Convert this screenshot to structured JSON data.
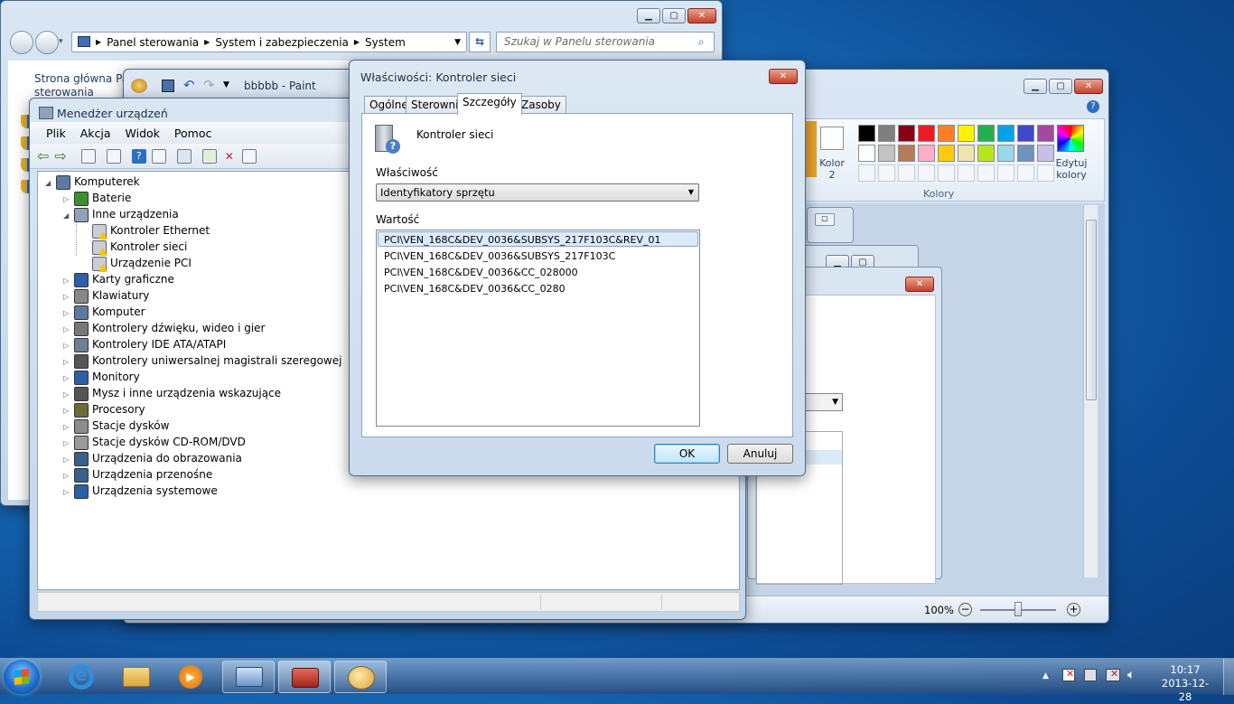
{
  "control_panel": {
    "breadcrumb": [
      "Panel sterowania",
      "System i zabezpieczenia",
      "System"
    ],
    "search_placeholder": "Szukaj w Panelu sterowania",
    "sidebar_link": "Strona główna Panelu sterowania",
    "sidebar_link_line1": "Strona główna Pan",
    "sidebar_link_line2": "sterowania"
  },
  "paint": {
    "title": "bbbbb - Paint",
    "color2_label_line1": "Kolor",
    "color2_label_line2": "2",
    "edit_colors_line1": "Edytuj",
    "edit_colors_line2": "kolory",
    "colors_group": "Kolory",
    "zoom": "100%",
    "palette_row1": [
      "#000000",
      "#7f7f7f",
      "#880015",
      "#ed1c24",
      "#ff7f27",
      "#fff200",
      "#22b14c",
      "#00a2e8",
      "#3f48cc",
      "#a349a4"
    ],
    "palette_row2": [
      "#ffffff",
      "#c3c3c3",
      "#b97a57",
      "#ffaec9",
      "#ffc90e",
      "#efe4b0",
      "#b5e61d",
      "#99d9ea",
      "#7092be",
      "#c8bfe7"
    ]
  },
  "device_manager": {
    "title": "Menedżer urządzeń",
    "menu": [
      "Plik",
      "Akcja",
      "Widok",
      "Pomoc"
    ],
    "tree": {
      "root": "Komputerek",
      "items": [
        {
          "label": "Baterie",
          "level": 1,
          "expanded": false
        },
        {
          "label": "Inne urządzenia",
          "level": 1,
          "expanded": true
        },
        {
          "label": "Kontroler Ethernet",
          "level": 2,
          "warning": true
        },
        {
          "label": "Kontroler sieci",
          "level": 2,
          "warning": true
        },
        {
          "label": "Urządzenie PCI",
          "level": 2,
          "warning": true
        },
        {
          "label": "Karty graficzne",
          "level": 1,
          "expanded": false
        },
        {
          "label": "Klawiatury",
          "level": 1,
          "expanded": false
        },
        {
          "label": "Komputer",
          "level": 1,
          "expanded": false
        },
        {
          "label": "Kontrolery dźwięku, wideo i gier",
          "level": 1,
          "expanded": false
        },
        {
          "label": "Kontrolery IDE ATA/ATAPI",
          "level": 1,
          "expanded": false
        },
        {
          "label": "Kontrolery uniwersalnej magistrali szeregowej",
          "level": 1,
          "expanded": false
        },
        {
          "label": "Monitory",
          "level": 1,
          "expanded": false
        },
        {
          "label": "Mysz i inne urządzenia wskazujące",
          "level": 1,
          "expanded": false
        },
        {
          "label": "Procesory",
          "level": 1,
          "expanded": false
        },
        {
          "label": "Stacje dysków",
          "level": 1,
          "expanded": false
        },
        {
          "label": "Stacje dysków CD-ROM/DVD",
          "level": 1,
          "expanded": false
        },
        {
          "label": "Urządzenia do obrazowania",
          "level": 1,
          "expanded": false
        },
        {
          "label": "Urządzenia przenośne",
          "level": 1,
          "expanded": false
        },
        {
          "label": "Urządzenia systemowe",
          "level": 1,
          "expanded": false
        }
      ]
    }
  },
  "dialog": {
    "title": "Właściwości: Kontroler sieci",
    "tabs": [
      "Ogólne",
      "Sterownik",
      "Szczegóły",
      "Zasoby"
    ],
    "active_tab": "Szczegóły",
    "device_name": "Kontroler sieci",
    "property_label": "Właściwość",
    "property_value": "Identyfikatory sprzętu",
    "value_label": "Wartość",
    "values": [
      "PCI\\VEN_168C&DEV_0036&SUBSYS_217F103C&REV_01",
      "PCI\\VEN_168C&DEV_0036&SUBSYS_217F103C",
      "PCI\\VEN_168C&DEV_0036&CC_028000",
      "PCI\\VEN_168C&DEV_0036&CC_0280"
    ],
    "selected_value_index": 0,
    "ok_label": "OK",
    "cancel_label": "Anuluj"
  },
  "taskbar": {
    "time": "10:17",
    "date": "2013-12-28"
  }
}
